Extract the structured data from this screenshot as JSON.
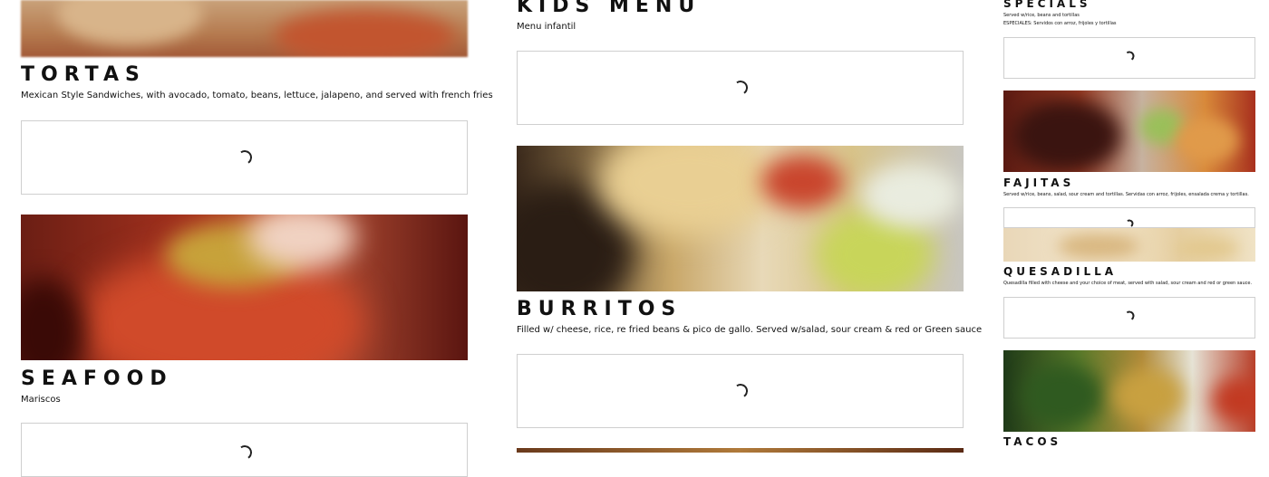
{
  "sections": {
    "tortas": {
      "title": "TORTAS",
      "desc": "Mexican Style Sandwiches, with avocado, tomato, beans, lettuce, jalapeno, and served with french fries"
    },
    "seafood": {
      "title": "SEAFOOD",
      "desc": "Mariscos"
    },
    "kids_menu": {
      "title": "KIDS MENU",
      "desc": "Menu infantil"
    },
    "burritos": {
      "title": "BURRITOS",
      "desc": "Filled w/ cheese, rice, re fried beans & pico de gallo. Served w/salad, sour cream & red or Green sauce"
    },
    "specials": {
      "title": "SPECIALS",
      "desc1": "Served w/rice, beans and tortillas",
      "desc2": "ESPECIALES: Servidos con arroz, frijoles y tortillas"
    },
    "fajitas": {
      "title": "FAJITAS",
      "desc": "Served w/rice, beans, salad, sour cream and tortillas. Servidas con arroz, frijoles, ensalada crema y tortillas."
    },
    "quesadilla": {
      "title": "QUESADILLA",
      "desc": "Quesadilla filled with cheese and your choice of meat, served with salad, sour cream and red or green sauce."
    },
    "tacos": {
      "title": "TACOS"
    }
  },
  "icons": {
    "loader": "loading-spinner-icon"
  },
  "colors": {
    "text": "#111111",
    "border": "#cfcfcf"
  }
}
